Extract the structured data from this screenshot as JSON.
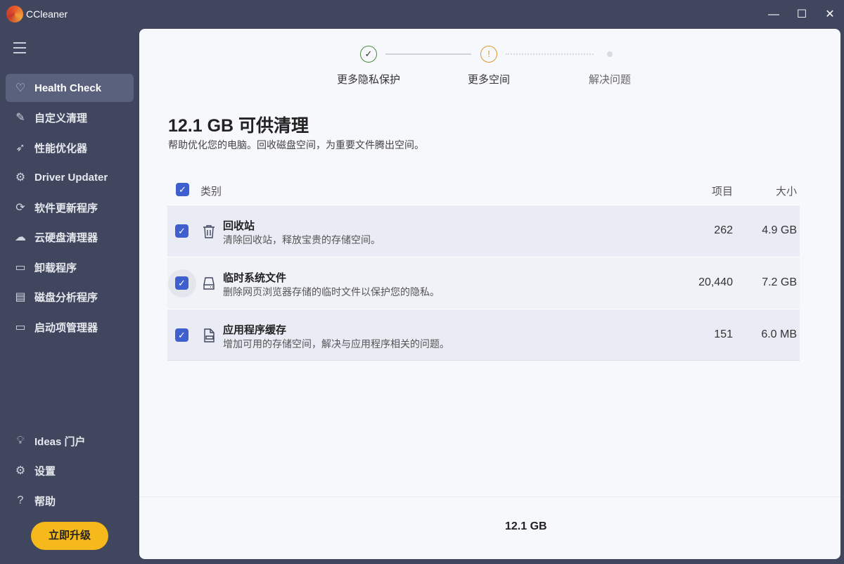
{
  "app": {
    "title": "CCleaner"
  },
  "sidebar": {
    "items": [
      {
        "label": "Health Check",
        "icon": "heart-icon"
      },
      {
        "label": "自定义清理",
        "icon": "brush-icon"
      },
      {
        "label": "性能优化器",
        "icon": "rocket-icon"
      },
      {
        "label": "Driver Updater",
        "icon": "gear-chip-icon"
      },
      {
        "label": "软件更新程序",
        "icon": "update-icon"
      },
      {
        "label": "云硬盘清理器",
        "icon": "cloud-icon"
      },
      {
        "label": "卸载程序",
        "icon": "uninstall-icon"
      },
      {
        "label": "磁盘分析程序",
        "icon": "disk-analyzer-icon"
      },
      {
        "label": "启动项管理器",
        "icon": "monitor-icon"
      }
    ],
    "bottom": [
      {
        "label": "Ideas 门户",
        "icon": "lightbulb-icon"
      },
      {
        "label": "设置",
        "icon": "gear-icon"
      },
      {
        "label": "帮助",
        "icon": "help-icon"
      }
    ],
    "upgrade": "立即升级"
  },
  "stepper": [
    {
      "label": "更多隐私保护",
      "status": "done"
    },
    {
      "label": "更多空间",
      "status": "warning"
    },
    {
      "label": "解决问题",
      "status": "pending"
    }
  ],
  "main": {
    "title": "12.1 GB 可供清理",
    "subtitle": "帮助优化您的电脑。回收磁盘空间，为重要文件腾出空间。",
    "headers": {
      "category": "类别",
      "items": "项目",
      "size": "大小"
    },
    "rows": [
      {
        "title": "回收站",
        "desc": "清除回收站，释放宝贵的存储空间。",
        "items": "262",
        "size": "4.9 GB",
        "checked": true
      },
      {
        "title": "临时系统文件",
        "desc": "删除网页浏览器存储的临时文件以保护您的隐私。",
        "items": "20,440",
        "size": "7.2 GB",
        "checked": true
      },
      {
        "title": "应用程序缓存",
        "desc": "增加可用的存储空间，解决与应用程序相关的问题。",
        "items": "151",
        "size": "6.0 MB",
        "checked": true
      }
    ],
    "total": "12.1 GB"
  },
  "colors": {
    "accent": "#3f5fcf",
    "sidebar": "#3f465e",
    "upgrade": "#f5b91c"
  }
}
